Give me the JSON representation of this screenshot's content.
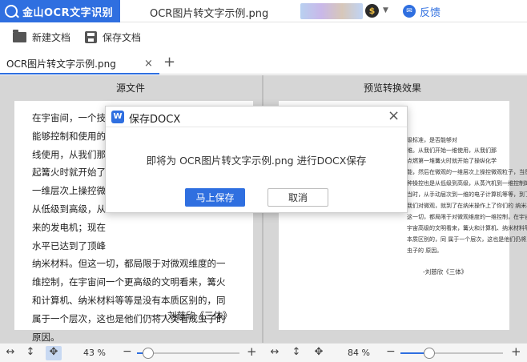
{
  "app": {
    "brand_name": "金山OCR文字识别",
    "window_title": "OCR图片转文字示例.png",
    "feedback_label": "反馈",
    "coin_glyph": "$",
    "accent_color": "#2f6fe0"
  },
  "toolbar": {
    "new_doc_label": "新建文档",
    "save_doc_label": "保存文档"
  },
  "tabs": [
    {
      "label": "OCR图片转文字示例.png",
      "close": "×"
    }
  ],
  "tab_add": "+",
  "panes": {
    "source_header": "源文件",
    "preview_header": "预览转换效果"
  },
  "source_doc": {
    "lines": [
      "在宇宙间，一个技",
      "能够控制和使用的",
      "线使用，从我们那",
      "起篝火时就开始了",
      "一维层次上操控微",
      "从低级到高级，从",
      "来的发电机；现在",
      "水平已达到了顶峰",
      "纳米材料。但这一切，都局限于对微观维度的一",
      "维控制，在宇宙间一个更高级的文明看来，篝火",
      "和计算机、纳米材料等等是没有本质区别的，同",
      "属于一个层次，这也是他们仍将人类看成虫子的",
      "原因。"
    ],
    "signature": "——刘慈欣《三体》"
  },
  "preview_doc": {
    "lines": [
      "级标准，是否能够对",
      "维。从我们开始一维使用，从我们那",
      "点燃第一堆篝火时就开始了操纵化学",
      "能，然后在微观的一维层次上操控微观粒子，当然，这",
      "种操控也是从低级到高级，从蒸汽机到一维控制的电",
      "当时，从手动层次到一维的电子计算机等等，到了现在",
      "我们对微观，就到了在纳米操作上了你们的 纳米材料，但",
      "这一切，都局限于对微观维度的一维控制，在宇宙间一个",
      "宇宙高级的文明看来，篝火和计算机、纳米材料等等是没有",
      "本质区别的，同 属于一个层次，这也是他们仍将人类看成",
      "虫子的 原因。"
    ],
    "signature": "-刘慈欣《三体》"
  },
  "statusbar": {
    "left": {
      "zoom": "43 %",
      "zoom_value": 43
    },
    "right": {
      "zoom": "84 %",
      "zoom_value": 84
    },
    "fit_width_glyph": "↔",
    "fit_height_glyph": "↕",
    "pan_glyph": "✥",
    "minus": "−",
    "plus": "+"
  },
  "dialog": {
    "logo_glyph": "W",
    "title": "保存DOCX",
    "close": "×",
    "message": "即将为 OCR图片转文字示例.png 进行DOCX保存",
    "confirm_label": "马上保存",
    "cancel_label": "取消"
  }
}
